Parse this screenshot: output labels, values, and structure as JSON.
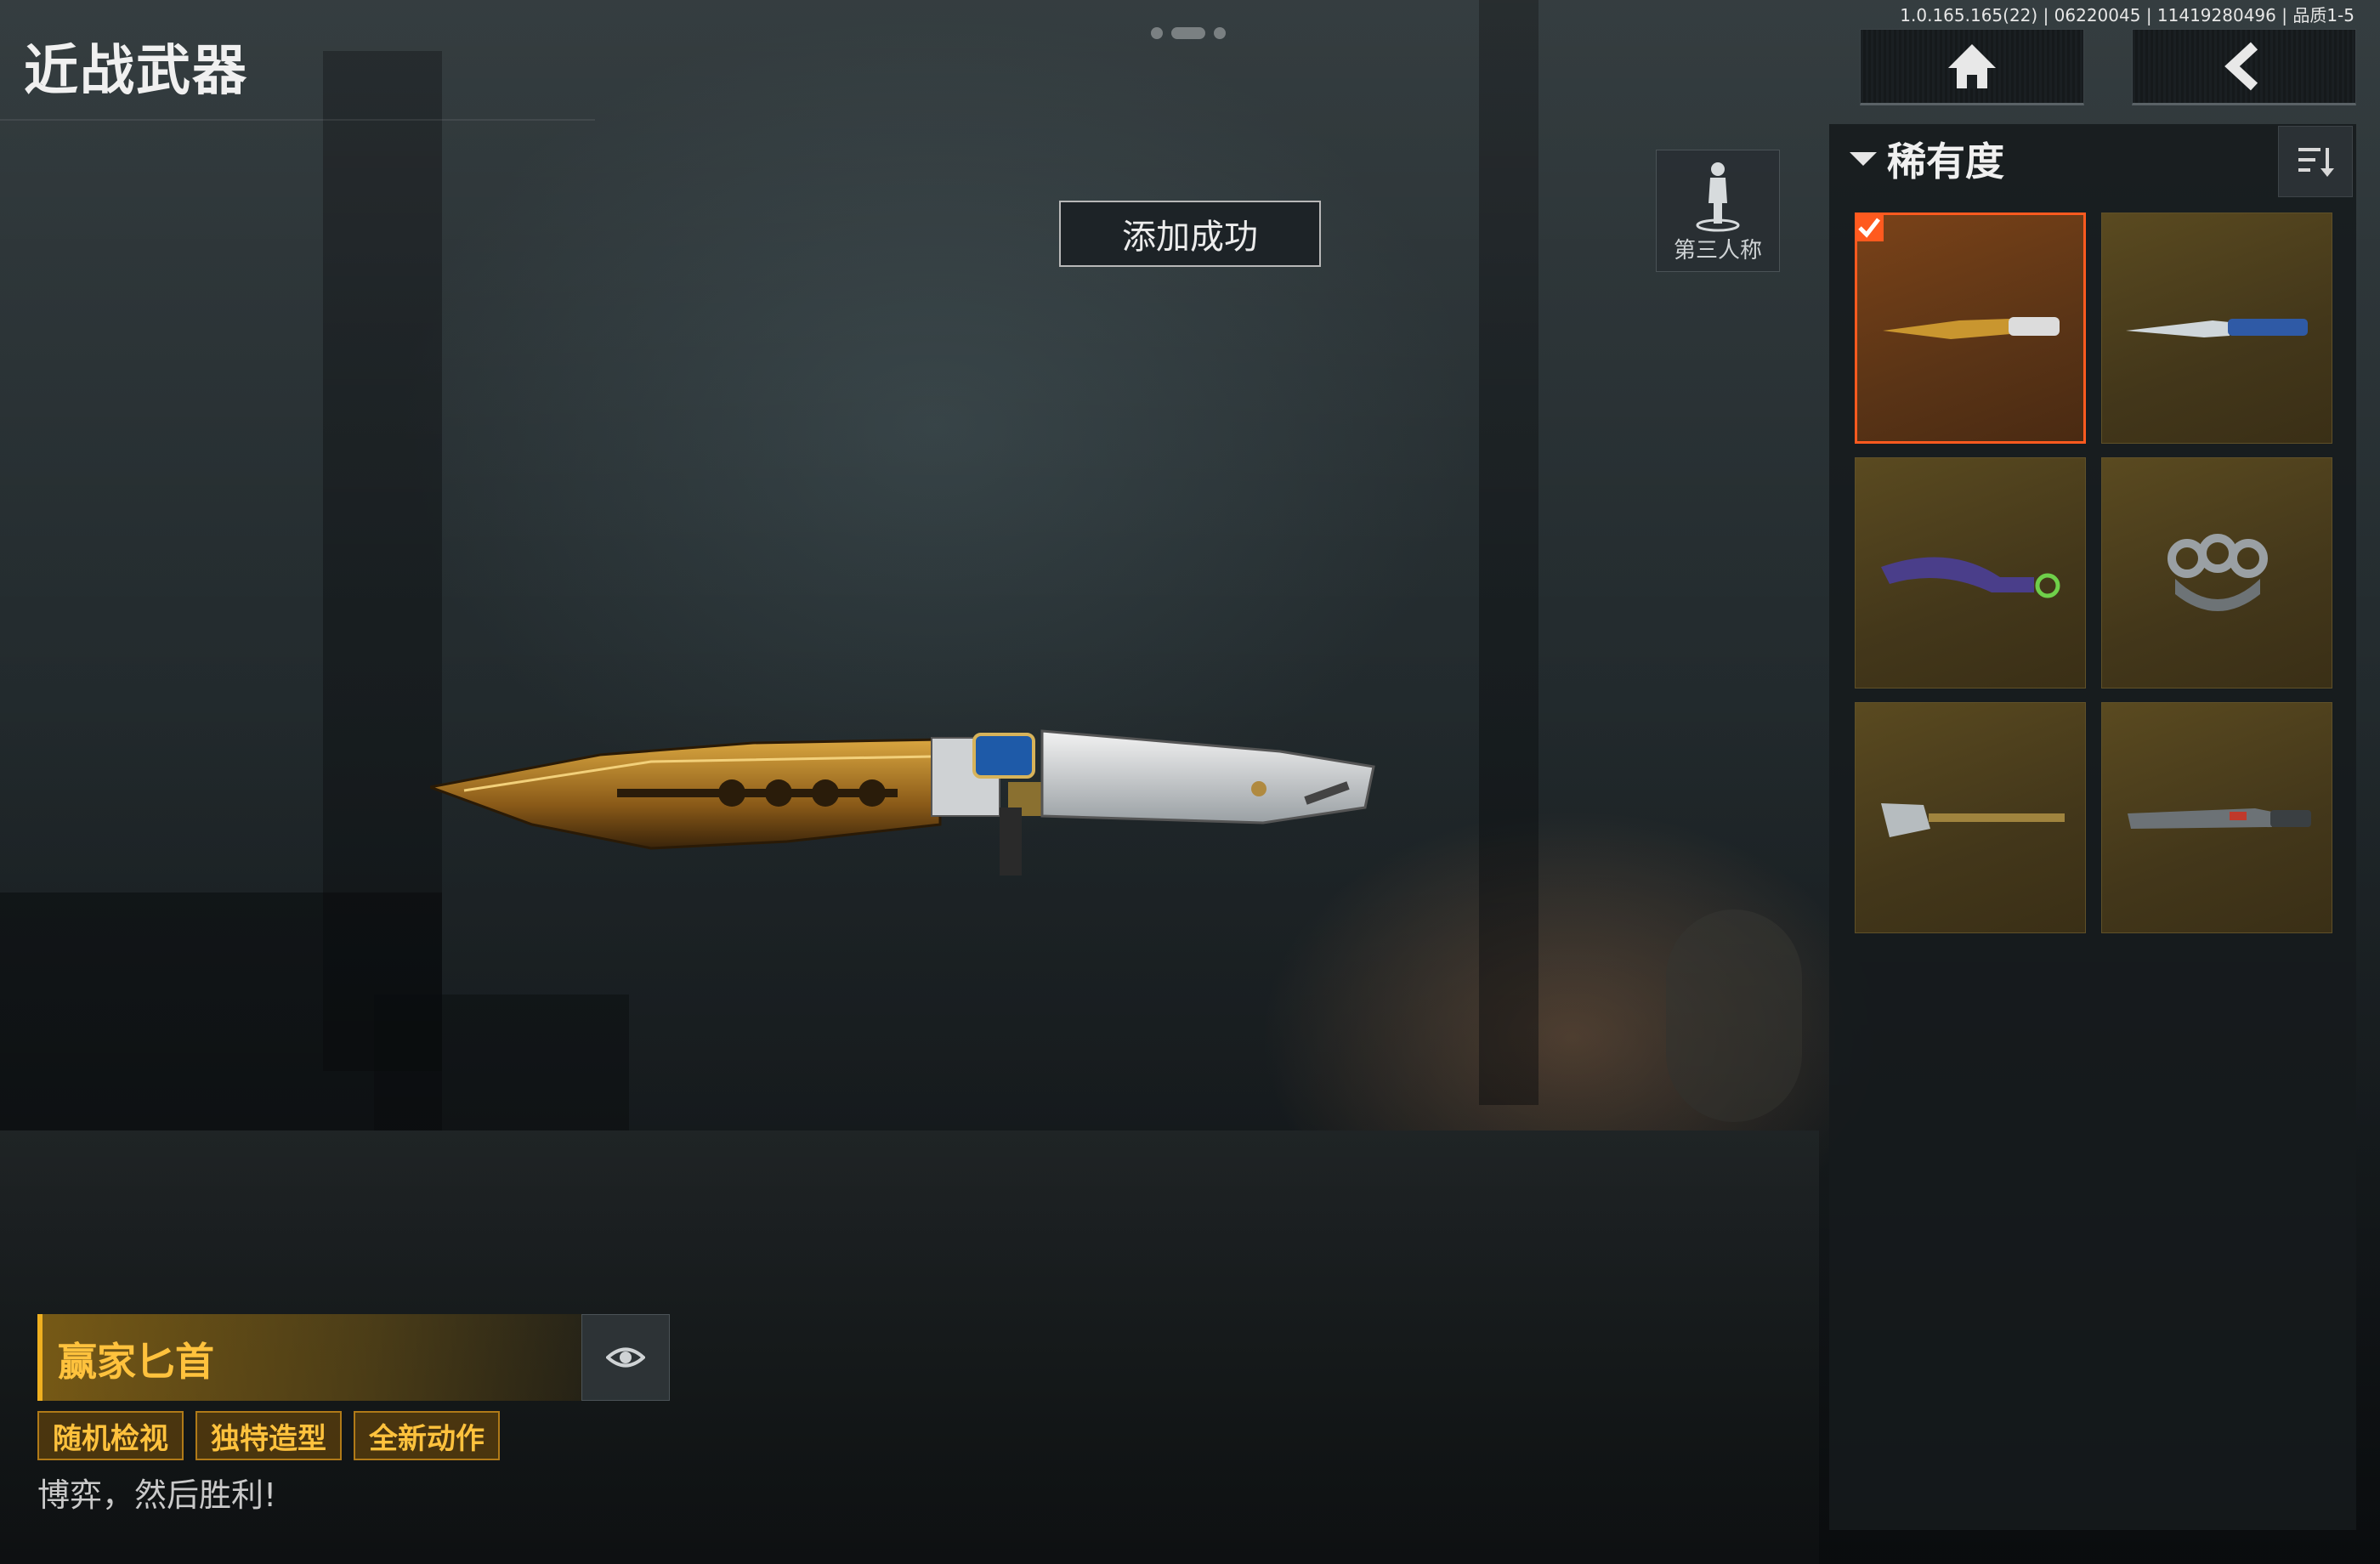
{
  "header": {
    "title": "近战武器",
    "version_info": "1.0.165.165(22) | 06220045 | 11419280496 | 品质1-5"
  },
  "nav": {
    "home_icon": "home-icon",
    "back_icon": "back-arrow-icon"
  },
  "toast": {
    "text": "添加成功"
  },
  "view_toggle": {
    "label": "第三人称",
    "icon": "person-icon"
  },
  "panel": {
    "sort_label": "稀有度",
    "items": [
      {
        "name": "ornate-gold-dagger",
        "selected": true
      },
      {
        "name": "blue-combat-knife",
        "selected": false
      },
      {
        "name": "purple-karambit",
        "selected": false
      },
      {
        "name": "brass-knuckles",
        "selected": false
      },
      {
        "name": "shovel",
        "selected": false
      },
      {
        "name": "machete",
        "selected": false
      }
    ]
  },
  "weapon": {
    "name": "赢家匕首",
    "tags": [
      "随机检视",
      "独特造型",
      "全新动作"
    ],
    "description": "博弈，然后胜利!"
  },
  "colors": {
    "accent_orange": "#ff5a1f",
    "gold_text": "#ffc23d",
    "tile_bg": "#4a3c1b"
  }
}
